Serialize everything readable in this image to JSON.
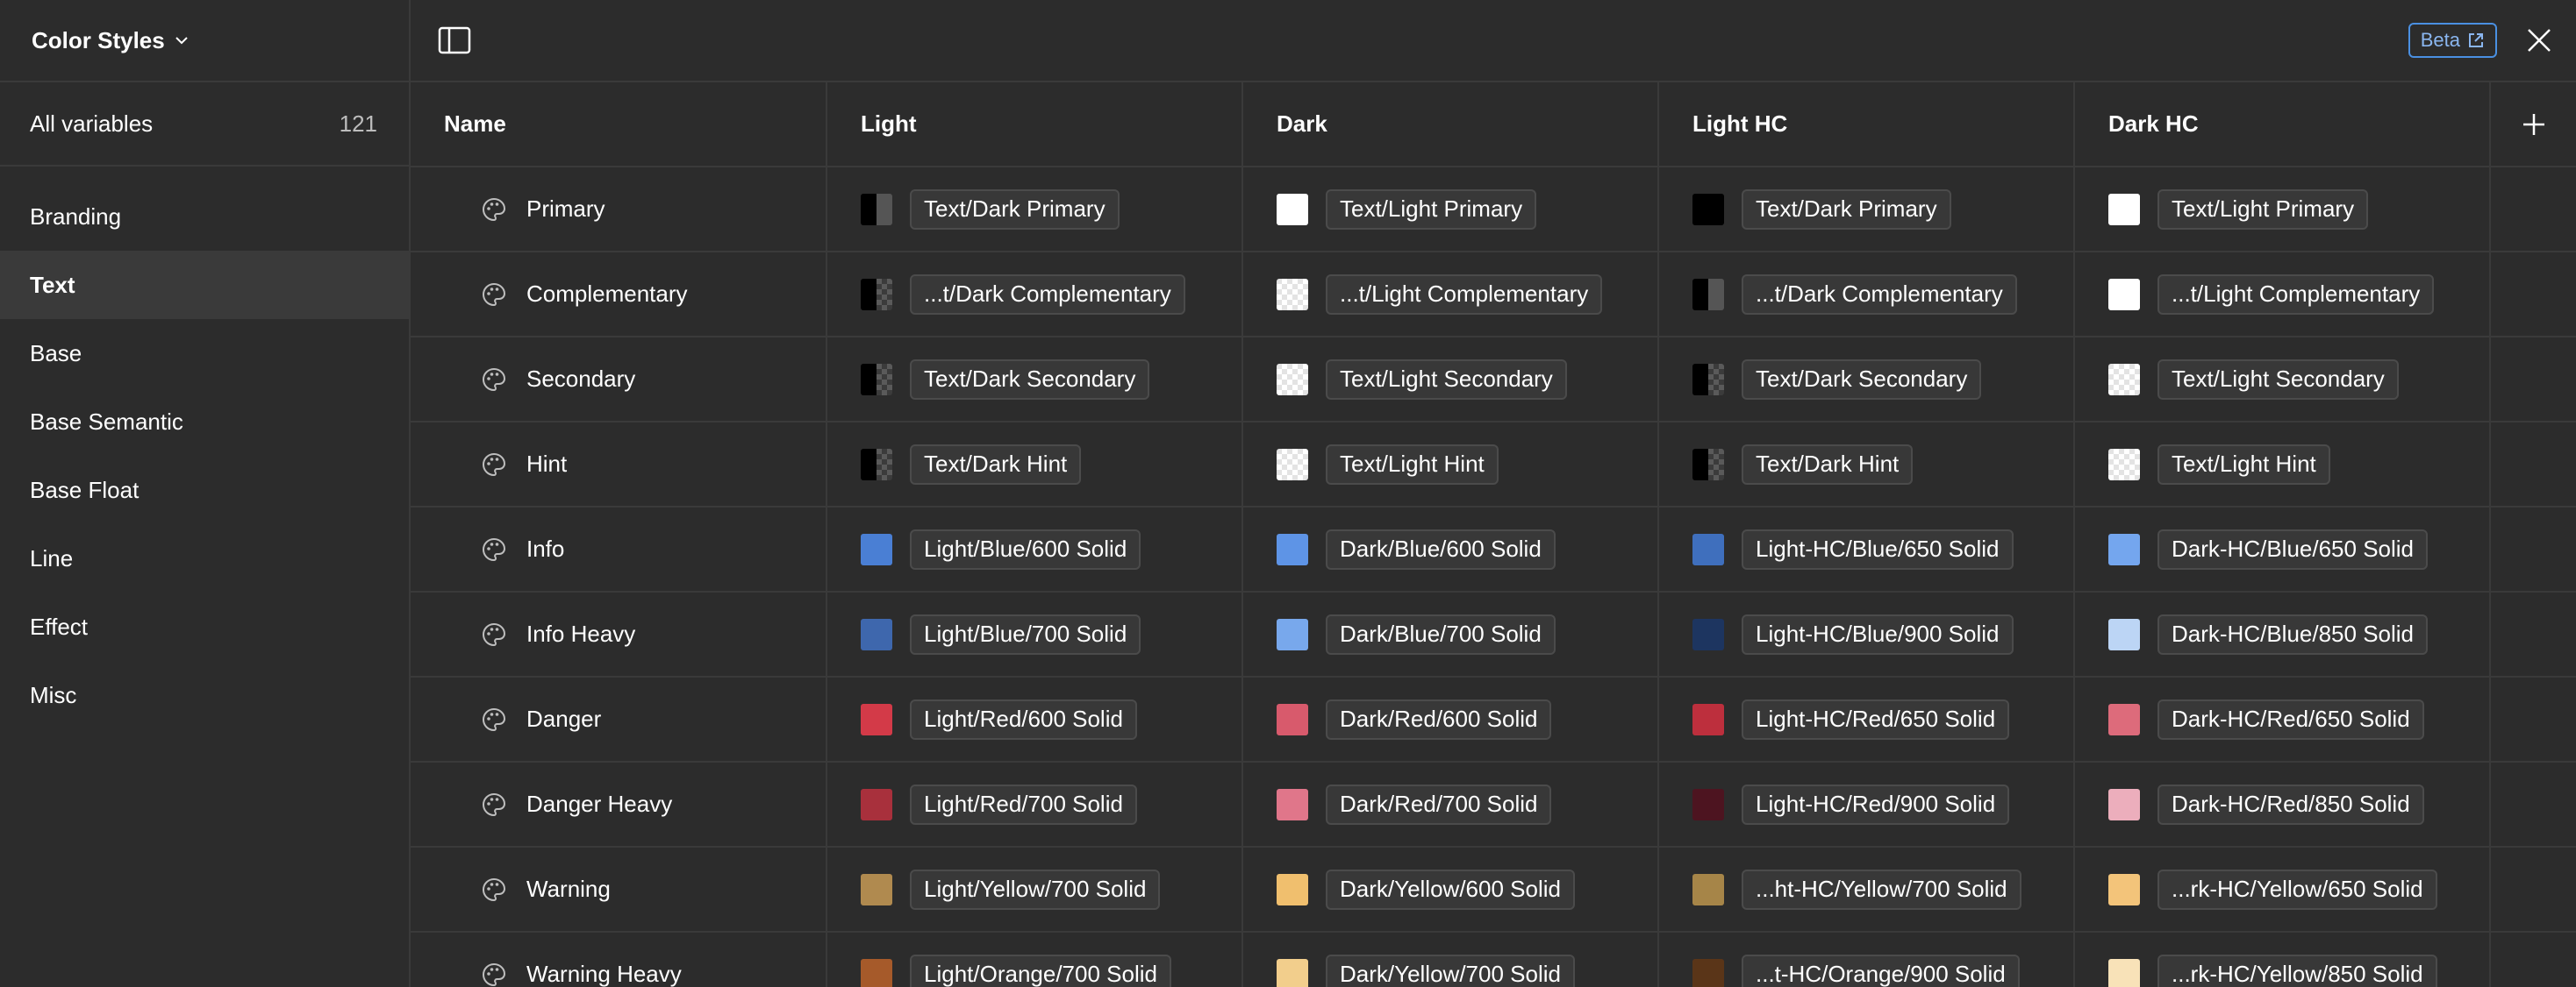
{
  "sidebar": {
    "title": "Color Styles",
    "all_label": "All variables",
    "all_count": "121",
    "groups": [
      "Branding",
      "Text",
      "Base",
      "Base Semantic",
      "Base Float",
      "Line",
      "Effect",
      "Misc"
    ],
    "active_group": "Text"
  },
  "topbar": {
    "beta_label": "Beta"
  },
  "table": {
    "headers": [
      "Name",
      "Light",
      "Dark",
      "Light HC",
      "Dark HC"
    ],
    "rows": [
      {
        "name": "Primary",
        "cells": [
          {
            "label": "Text/Dark Primary",
            "swatch": "split-dark",
            "color": "#000000"
          },
          {
            "label": "Text/Light Primary",
            "swatch": "solid",
            "color": "#ffffff"
          },
          {
            "label": "Text/Dark Primary",
            "swatch": "solid",
            "color": "#000000"
          },
          {
            "label": "Text/Light Primary",
            "swatch": "solid",
            "color": "#ffffff"
          }
        ]
      },
      {
        "name": "Complementary",
        "cells": [
          {
            "label": "...t/Dark Complementary",
            "swatch": "split-dark-check",
            "color": "#000000"
          },
          {
            "label": "...t/Light Complementary",
            "swatch": "light-check",
            "color": "#ffffff"
          },
          {
            "label": "...t/Dark Complementary",
            "swatch": "split-dark",
            "color": "#000000"
          },
          {
            "label": "...t/Light Complementary",
            "swatch": "solid",
            "color": "#ffffff"
          }
        ]
      },
      {
        "name": "Secondary",
        "cells": [
          {
            "label": "Text/Dark Secondary",
            "swatch": "split-dark-check",
            "color": "#000000"
          },
          {
            "label": "Text/Light Secondary",
            "swatch": "light-check",
            "color": "#ffffff"
          },
          {
            "label": "Text/Dark Secondary",
            "swatch": "split-dark-check",
            "color": "#000000"
          },
          {
            "label": "Text/Light Secondary",
            "swatch": "light-check",
            "color": "#ffffff"
          }
        ]
      },
      {
        "name": "Hint",
        "cells": [
          {
            "label": "Text/Dark Hint",
            "swatch": "split-dark-check",
            "color": "#000000"
          },
          {
            "label": "Text/Light Hint",
            "swatch": "light-check",
            "color": "#ffffff"
          },
          {
            "label": "Text/Dark Hint",
            "swatch": "split-dark-check",
            "color": "#000000"
          },
          {
            "label": "Text/Light Hint",
            "swatch": "light-check",
            "color": "#ffffff"
          }
        ]
      },
      {
        "name": "Info",
        "cells": [
          {
            "label": "Light/Blue/600 Solid",
            "swatch": "solid",
            "color": "#4a7fd4"
          },
          {
            "label": "Dark/Blue/600 Solid",
            "swatch": "solid",
            "color": "#5e94e6"
          },
          {
            "label": "Light-HC/Blue/650 Solid",
            "swatch": "solid",
            "color": "#3f6fbd"
          },
          {
            "label": "Dark-HC/Blue/650 Solid",
            "swatch": "solid",
            "color": "#74a6ee"
          }
        ]
      },
      {
        "name": "Info Heavy",
        "cells": [
          {
            "label": "Light/Blue/700 Solid",
            "swatch": "solid",
            "color": "#3e67ad"
          },
          {
            "label": "Dark/Blue/700 Solid",
            "swatch": "solid",
            "color": "#78a8ec"
          },
          {
            "label": "Light-HC/Blue/900 Solid",
            "swatch": "solid",
            "color": "#1d3560"
          },
          {
            "label": "Dark-HC/Blue/850 Solid",
            "swatch": "solid",
            "color": "#bcd5f5"
          }
        ]
      },
      {
        "name": "Danger",
        "cells": [
          {
            "label": "Light/Red/600 Solid",
            "swatch": "solid",
            "color": "#d33a48"
          },
          {
            "label": "Dark/Red/600 Solid",
            "swatch": "solid",
            "color": "#d85a6c"
          },
          {
            "label": "Light-HC/Red/650 Solid",
            "swatch": "solid",
            "color": "#bd2f3d"
          },
          {
            "label": "Dark-HC/Red/650 Solid",
            "swatch": "solid",
            "color": "#dd6b7b"
          }
        ]
      },
      {
        "name": "Danger Heavy",
        "cells": [
          {
            "label": "Light/Red/700 Solid",
            "swatch": "solid",
            "color": "#a8303c"
          },
          {
            "label": "Dark/Red/700 Solid",
            "swatch": "solid",
            "color": "#e0768a"
          },
          {
            "label": "Light-HC/Red/900 Solid",
            "swatch": "solid",
            "color": "#4d1420"
          },
          {
            "label": "Dark-HC/Red/850 Solid",
            "swatch": "solid",
            "color": "#ecaebc"
          }
        ]
      },
      {
        "name": "Warning",
        "cells": [
          {
            "label": "Light/Yellow/700 Solid",
            "swatch": "solid",
            "color": "#b08a4f"
          },
          {
            "label": "Dark/Yellow/600 Solid",
            "swatch": "solid",
            "color": "#f0bf6e"
          },
          {
            "label": "...ht-HC/Yellow/700 Solid",
            "swatch": "solid",
            "color": "#a68548"
          },
          {
            "label": "...rk-HC/Yellow/650 Solid",
            "swatch": "solid",
            "color": "#f3c47a"
          }
        ]
      },
      {
        "name": "Warning Heavy",
        "cells": [
          {
            "label": "Light/Orange/700 Solid",
            "swatch": "solid",
            "color": "#a65a2a"
          },
          {
            "label": "Dark/Yellow/700 Solid",
            "swatch": "solid",
            "color": "#f2ce8c"
          },
          {
            "label": "...t-HC/Orange/900 Solid",
            "swatch": "solid",
            "color": "#5a3518"
          },
          {
            "label": "...rk-HC/Yellow/850 Solid",
            "swatch": "solid",
            "color": "#f8e2b8"
          }
        ]
      }
    ]
  }
}
